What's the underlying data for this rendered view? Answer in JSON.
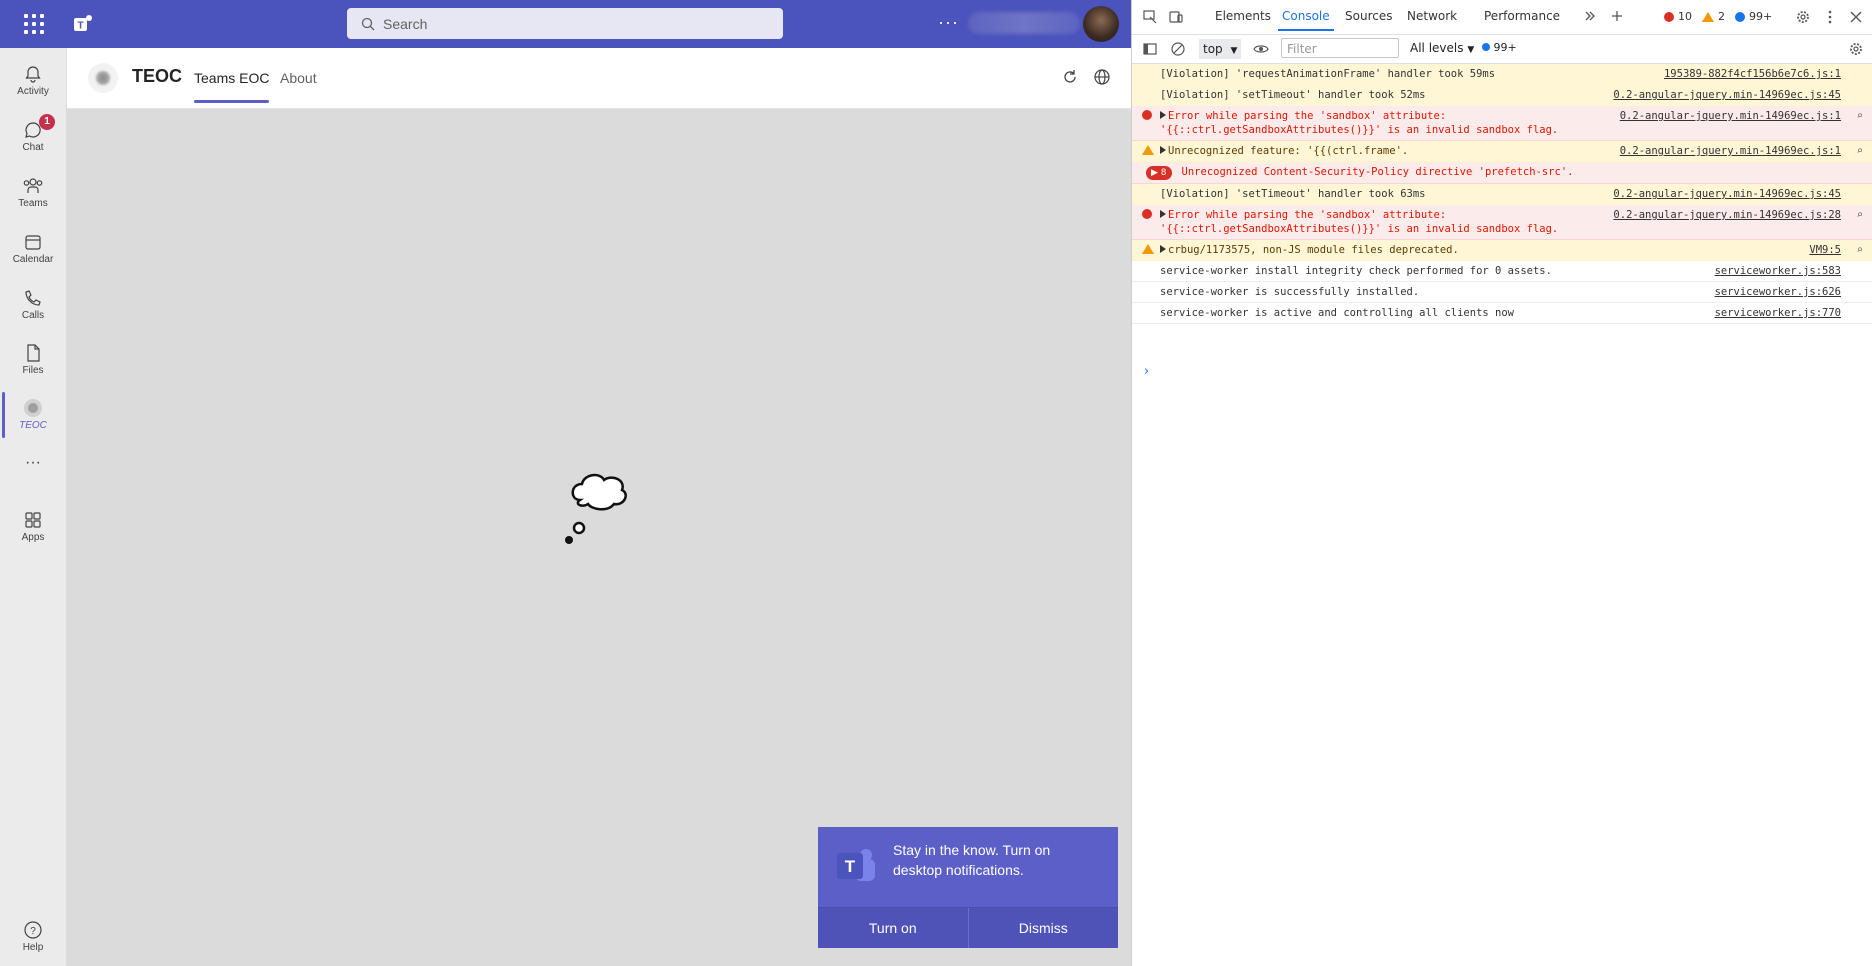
{
  "teams": {
    "search_placeholder": "Search",
    "more": "···",
    "rail": [
      {
        "label": "Activity",
        "badge": ""
      },
      {
        "label": "Chat",
        "badge": "1"
      },
      {
        "label": "Teams",
        "badge": ""
      },
      {
        "label": "Calendar",
        "badge": ""
      },
      {
        "label": "Calls",
        "badge": ""
      },
      {
        "label": "Files",
        "badge": ""
      },
      {
        "label": "TEOC",
        "badge": ""
      },
      {
        "label": "···",
        "badge": ""
      },
      {
        "label": "Apps",
        "badge": ""
      },
      {
        "label": "Help",
        "badge": ""
      }
    ],
    "app_name": "TEOC",
    "tabs": [
      "Teams EOC",
      "About"
    ],
    "toast": {
      "message": "Stay in the know. Turn on desktop notifications.",
      "turn_on": "Turn on",
      "dismiss": "Dismiss"
    },
    "accent": "#4b53bc"
  },
  "devtools": {
    "tabs": [
      "Elements",
      "Console",
      "Sources",
      "Network",
      "Performance"
    ],
    "counts": {
      "errors": "10",
      "warnings": "2",
      "info": "99+"
    },
    "context": "top",
    "filter_placeholder": "Filter",
    "levels": "All levels",
    "issues": "99+",
    "messages": [
      {
        "type": "viol",
        "text": "[Violation] 'requestAnimationFrame' handler took 59ms",
        "src": "195389-882f4cf156b6e7c6.js:1"
      },
      {
        "type": "viol",
        "text": "[Violation] 'setTimeout' handler took 52ms",
        "src": "0.2-angular-jquery.min-14969ec.js:45"
      },
      {
        "type": "err",
        "text": "Error while parsing the 'sandbox' attribute: '{{::ctrl.getSandboxAttributes()}}' is an invalid sandbox flag.",
        "src": "0.2-angular-jquery.min-14969ec.js:1"
      },
      {
        "type": "warn",
        "text": "Unrecognized feature: '{{(ctrl.frame'.",
        "src": "0.2-angular-jquery.min-14969ec.js:1"
      },
      {
        "type": "errcount",
        "count": "8",
        "text": "Unrecognized Content-Security-Policy directive 'prefetch-src'.",
        "src": ""
      },
      {
        "type": "viol",
        "text": "[Violation] 'setTimeout' handler took 63ms",
        "src": "0.2-angular-jquery.min-14969ec.js:45"
      },
      {
        "type": "err",
        "text": "Error while parsing the 'sandbox' attribute: '{{::ctrl.getSandboxAttributes()}}' is an invalid sandbox flag.",
        "src": "0.2-angular-jquery.min-14969ec.js:28"
      },
      {
        "type": "warn",
        "text": "crbug/1173575, non-JS module files deprecated.",
        "src": "VM9:5"
      },
      {
        "type": "plain",
        "text": "service-worker install integrity check performed for 0 assets.",
        "src": "serviceworker.js:583"
      },
      {
        "type": "plain",
        "text": "service-worker is successfully installed.",
        "src": "serviceworker.js:626"
      },
      {
        "type": "plain",
        "text": "service-worker is active and controlling all clients now",
        "src": "serviceworker.js:770"
      }
    ]
  }
}
